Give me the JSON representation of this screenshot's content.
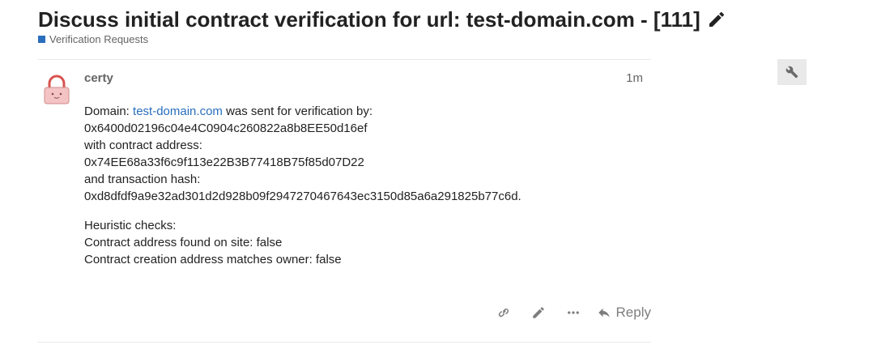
{
  "topic": {
    "title": "Discuss initial contract verification for url: test-domain.com - [111]",
    "category": {
      "name": "Verification Requests",
      "color": "#2a6ebc"
    }
  },
  "post": {
    "username": "certy",
    "time": "1m",
    "body": {
      "line1_prefix": "Domain: ",
      "line1_link": "test-domain.com",
      "line1_suffix": " was sent for verification by:",
      "sender_address": "0x6400d02196c04e4C0904c260822a8b8EE50d16ef",
      "contract_label": "with contract address:",
      "contract_address": "0x74EE68a33f6c9f113e22B3B77418B75f85d07D22",
      "tx_label": "and transaction hash:",
      "tx_hash": "0xd8dfdf9a9e32ad301d2d928b09f2947270467643ec3150d85a6a291825b77c6d.",
      "heuristic_title": "Heuristic checks:",
      "check1": "Contract address found on site: false",
      "check2": "Contract creation address matches owner: false"
    },
    "actions": {
      "reply_label": "Reply",
      "icons": [
        "link-icon",
        "pencil-icon",
        "ellipsis-icon",
        "reply-icon"
      ]
    }
  },
  "admin": {
    "icon": "wrench-icon"
  }
}
